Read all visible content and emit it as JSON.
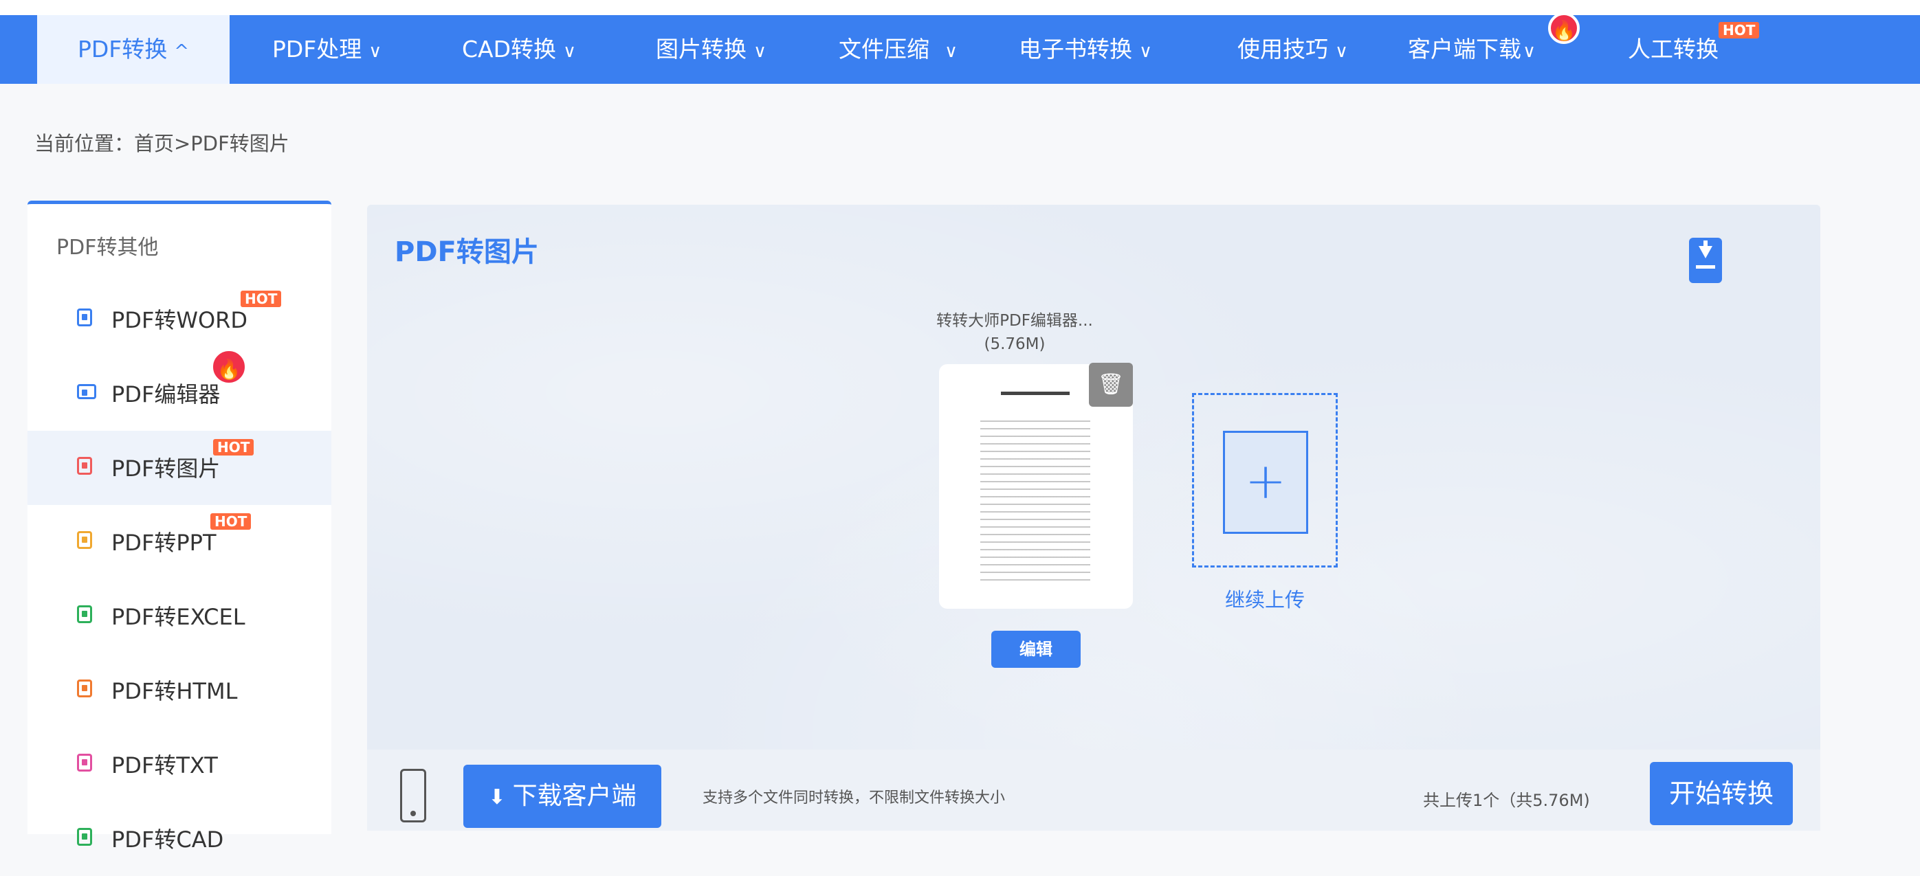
{
  "nav": {
    "items": [
      {
        "label": "PDF转换",
        "chevron": "^"
      },
      {
        "label": "PDF处理",
        "chevron": "∨"
      },
      {
        "label": "CAD转换",
        "chevron": "∨"
      },
      {
        "label": "图片转换",
        "chevron": "∨"
      },
      {
        "label": "文件压缩",
        "chevron": "∨"
      },
      {
        "label": "电子书转换",
        "chevron": "∨"
      },
      {
        "label": "使用技巧",
        "chevron": "∨"
      },
      {
        "label": "客户端下载",
        "chevron": "∨"
      },
      {
        "label": "人工转换"
      }
    ],
    "hot_badge": "HOT",
    "fire_icon": "fire-icon",
    "accent_color": "#3a7ff0"
  },
  "breadcrumb": "当前位置：首页>PDF转图片",
  "sidebar": {
    "heading": "PDF转其他",
    "items": [
      {
        "label": "PDF转WORD",
        "badge": "HOT",
        "color": "#3a7ff0"
      },
      {
        "label": "PDF编辑器",
        "color": "#3a7ff0"
      },
      {
        "label": "PDF转图片",
        "badge": "HOT",
        "color": "#f05b5b"
      },
      {
        "label": "PDF转PPT",
        "badge": "HOT",
        "color": "#f0a830"
      },
      {
        "label": "PDF转EXCEL",
        "color": "#2db05a"
      },
      {
        "label": "PDF转HTML",
        "color": "#f07a30"
      },
      {
        "label": "PDF转TXT",
        "color": "#e24fa0"
      },
      {
        "label": "PDF转CAD",
        "color": "#2db05a"
      }
    ]
  },
  "main": {
    "title": "PDF转图片",
    "file": {
      "name": "转转大师PDF编辑器...",
      "size": "(5.76M)"
    },
    "edit_label": "编辑",
    "continue_upload": "继续上传",
    "bottom": {
      "download_client": "下载客户端",
      "support_text": "支持多个文件同时转换，不限制文件转换大小",
      "uploaded_text": "共上传1个（共5.76M)",
      "start_convert": "开始转换"
    }
  }
}
